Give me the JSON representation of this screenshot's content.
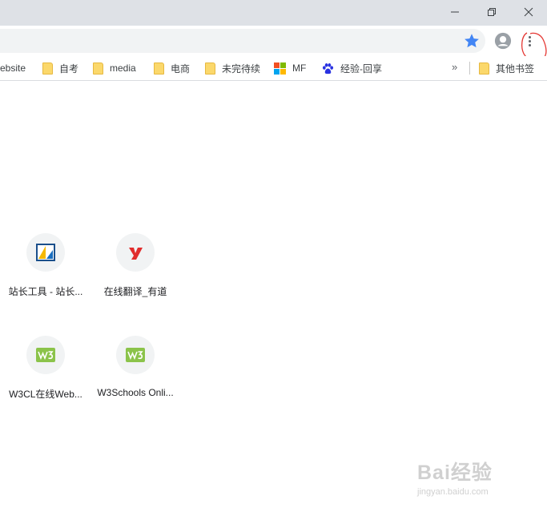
{
  "window": {
    "minimize_label": "minimize",
    "restore_label": "restore",
    "close_label": "close"
  },
  "bookmarks": {
    "items": [
      {
        "label": "ebsite",
        "type": "partial"
      },
      {
        "label": "自考",
        "type": "folder"
      },
      {
        "label": "media",
        "type": "folder"
      },
      {
        "label": "电商",
        "type": "folder"
      },
      {
        "label": "未完待续",
        "type": "folder"
      },
      {
        "label": "MF",
        "type": "microsoft"
      },
      {
        "label": "经验-回享",
        "type": "baidu"
      }
    ],
    "more_label": "»",
    "other_label": "其他书签"
  },
  "shortcuts": [
    {
      "label": "站长工具 - 站长...",
      "icon": "chinaz-icon"
    },
    {
      "label": "在线翻译_有道",
      "icon": "youdao-icon"
    },
    {
      "label": "W3CL在线Web...",
      "icon": "w3-icon"
    },
    {
      "label": "W3Schools Onli...",
      "icon": "w3-icon"
    }
  ],
  "watermark": {
    "brand": "Bai经验",
    "url": "jingyan.baidu.com"
  },
  "colors": {
    "titlebar": "#dee1e6",
    "accent": "#4285f4",
    "folder": "#fbd86b",
    "annotation": "#e53935"
  }
}
